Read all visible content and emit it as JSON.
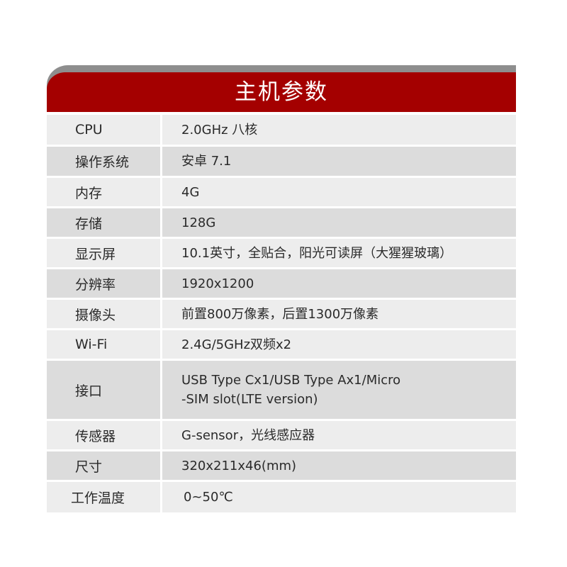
{
  "header": {
    "title": "主机参数"
  },
  "colors": {
    "accent": "#a40000",
    "header_shadow": "#8e8e8e",
    "row_light": "#ededed",
    "row_dark": "#dcdcdc"
  },
  "specs": [
    {
      "label": "CPU",
      "value": "2.0GHz 八核"
    },
    {
      "label": "操作系统",
      "value": "安卓 7.1"
    },
    {
      "label": "内存",
      "value": "4G"
    },
    {
      "label": "存储",
      "value": "128G"
    },
    {
      "label": "显示屏",
      "value": "10.1英寸，全贴合，阳光可读屏（大猩猩玻璃）"
    },
    {
      "label": "分辨率",
      "value": "1920x1200"
    },
    {
      "label": "摄像头",
      "value": "前置800万像素，后置1300万像素"
    },
    {
      "label": "Wi-Fi",
      "value": "2.4G/5GHz双频x2"
    },
    {
      "label": "接口",
      "value_line1": "USB Type Cx1/USB  Type Ax1/Micro",
      "value_line2": "-SIM slot(LTE version)"
    },
    {
      "label": "传感器",
      "value": "G-sensor，光线感应器"
    },
    {
      "label": "尺寸",
      "value": "320x211x46(mm)"
    },
    {
      "label": "工作温度",
      "value": "0~50℃"
    }
  ]
}
